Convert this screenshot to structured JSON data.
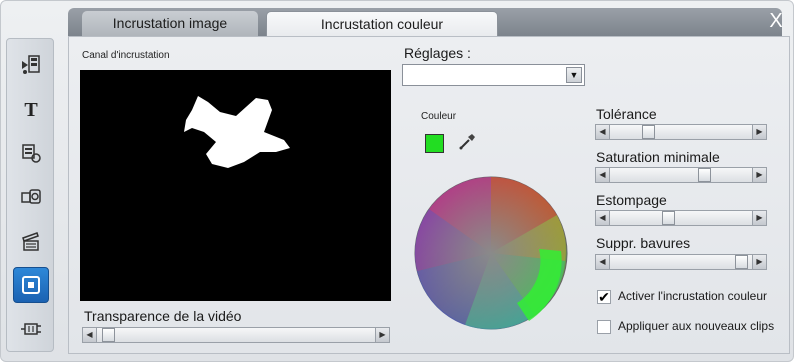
{
  "tabs": [
    {
      "label": "Incrustation image",
      "active": false
    },
    {
      "label": "Incrustation couleur",
      "active": true
    }
  ],
  "close_label": "X",
  "toolbar": {
    "items": [
      {
        "icon": "transitions-icon",
        "active": false
      },
      {
        "icon": "title-text-icon",
        "active": false
      },
      {
        "icon": "effects-icon",
        "active": false
      },
      {
        "icon": "camera-icon",
        "active": false
      },
      {
        "icon": "clapperboard-icon",
        "active": false
      },
      {
        "icon": "overlay-icon",
        "active": true
      },
      {
        "icon": "plugin-icon",
        "active": false
      }
    ]
  },
  "preview": {
    "label": "Canal d'incrustation"
  },
  "video_transparency": {
    "label": "Transparence de la vidéo",
    "value": 0.02
  },
  "settings": {
    "label": "Réglages :",
    "selected": ""
  },
  "color": {
    "label": "Couleur",
    "swatch": "#22dd22"
  },
  "tolerance": {
    "label": "Tolérance",
    "value": 0.25
  },
  "min_saturation": {
    "label": "Saturation minimale",
    "value": 0.68
  },
  "blur": {
    "label": "Estompage",
    "value": 0.4
  },
  "remove_fringes": {
    "label": "Suppr. bavures",
    "value": 0.97
  },
  "enable_chroma": {
    "label": "Activer l'incrustation couleur",
    "checked": true
  },
  "apply_new_clips": {
    "label": "Appliquer aux nouveaux clips",
    "checked": false
  }
}
